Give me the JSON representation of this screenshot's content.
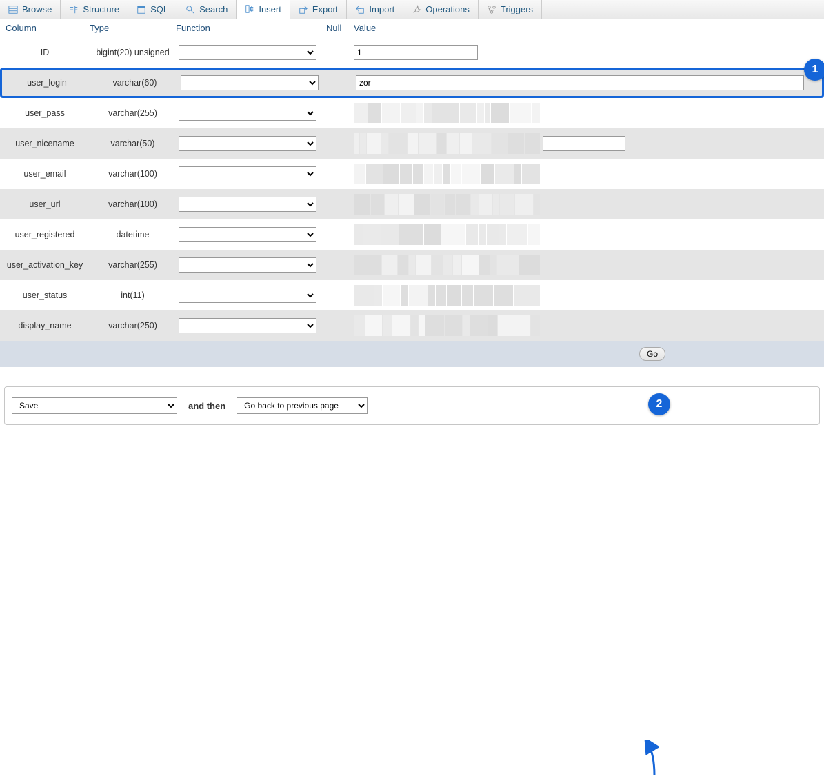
{
  "tabs": [
    {
      "label": "Browse",
      "icon": "browse"
    },
    {
      "label": "Structure",
      "icon": "structure"
    },
    {
      "label": "SQL",
      "icon": "sql"
    },
    {
      "label": "Search",
      "icon": "search"
    },
    {
      "label": "Insert",
      "icon": "insert",
      "active": true
    },
    {
      "label": "Export",
      "icon": "export"
    },
    {
      "label": "Import",
      "icon": "import"
    },
    {
      "label": "Operations",
      "icon": "operations"
    },
    {
      "label": "Triggers",
      "icon": "triggers"
    }
  ],
  "headers": {
    "column": "Column",
    "type": "Type",
    "function": "Function",
    "null": "Null",
    "value": "Value"
  },
  "rows": [
    {
      "column": "ID",
      "type": "bigint(20) unsigned",
      "value": "1",
      "value_style": "narrow",
      "blur": false,
      "highlight": false
    },
    {
      "column": "user_login",
      "type": "varchar(60)",
      "value": "zor",
      "value_style": "wide",
      "blur": false,
      "highlight": true
    },
    {
      "column": "user_pass",
      "type": "varchar(255)",
      "value": "",
      "value_style": "blur",
      "blur": true
    },
    {
      "column": "user_nicename",
      "type": "varchar(50)",
      "value": "",
      "value_style": "mid_blur",
      "blur": true
    },
    {
      "column": "user_email",
      "type": "varchar(100)",
      "value": "",
      "value_style": "blur",
      "blur": true
    },
    {
      "column": "user_url",
      "type": "varchar(100)",
      "value": "",
      "value_style": "blur",
      "blur": true
    },
    {
      "column": "user_registered",
      "type": "datetime",
      "value": "",
      "value_style": "blur",
      "blur": true
    },
    {
      "column": "user_activation_key",
      "type": "varchar(255)",
      "value": "",
      "value_style": "blur",
      "blur": true
    },
    {
      "column": "user_status",
      "type": "int(11)",
      "value": "",
      "value_style": "blur",
      "blur": true
    },
    {
      "column": "display_name",
      "type": "varchar(250)",
      "value": "",
      "value_style": "blur",
      "blur": true
    }
  ],
  "go_label": "Go",
  "bottom": {
    "save": "Save",
    "and_then": "and then",
    "go_back": "Go back to previous page"
  },
  "annot": {
    "1": "1",
    "2": "2"
  }
}
